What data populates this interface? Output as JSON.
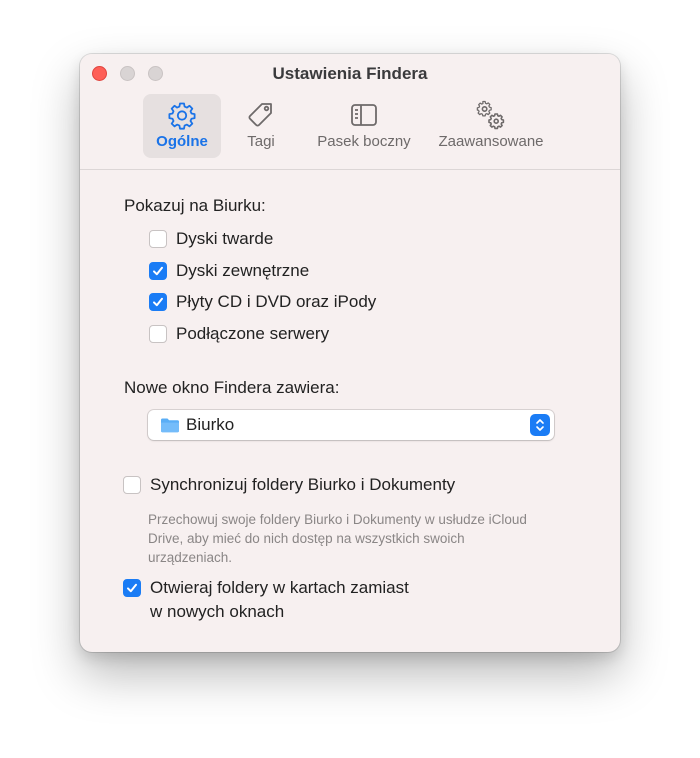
{
  "window": {
    "title": "Ustawienia Findera"
  },
  "tabs": [
    {
      "label": "Ogólne",
      "icon": "gear-icon",
      "active": true
    },
    {
      "label": "Tagi",
      "icon": "tag-icon",
      "active": false
    },
    {
      "label": "Pasek boczny",
      "icon": "sidebar-icon",
      "active": false
    },
    {
      "label": "Zaawansowane",
      "icon": "gears-icon",
      "active": false
    }
  ],
  "desktop_section": {
    "label": "Pokazuj na Biurku:",
    "items": [
      {
        "label": "Dyski twarde",
        "checked": false
      },
      {
        "label": "Dyski zewnętrzne",
        "checked": true
      },
      {
        "label": "Płyty CD i DVD oraz iPody",
        "checked": true
      },
      {
        "label": "Podłączone serwery",
        "checked": false
      }
    ]
  },
  "new_window": {
    "label": "Nowe okno Findera zawiera:",
    "selected": "Biurko",
    "icon": "folder-icon"
  },
  "sync": {
    "label": "Synchronizuj foldery Biurko i Dokumenty",
    "checked": false,
    "description": "Przechowuj swoje foldery Biurko i Dokumenty w usłudze iCloud Drive, aby mieć do nich dostęp na wszystkich swoich urządzeniach."
  },
  "open_tabs": {
    "label_line1": "Otwieraj foldery w kartach zamiast",
    "label_line2": "w nowych oknach",
    "checked": true
  },
  "colors": {
    "accent": "#1a7cf5",
    "close": "#fe5f57",
    "window_bg": "#f7f0f0"
  }
}
